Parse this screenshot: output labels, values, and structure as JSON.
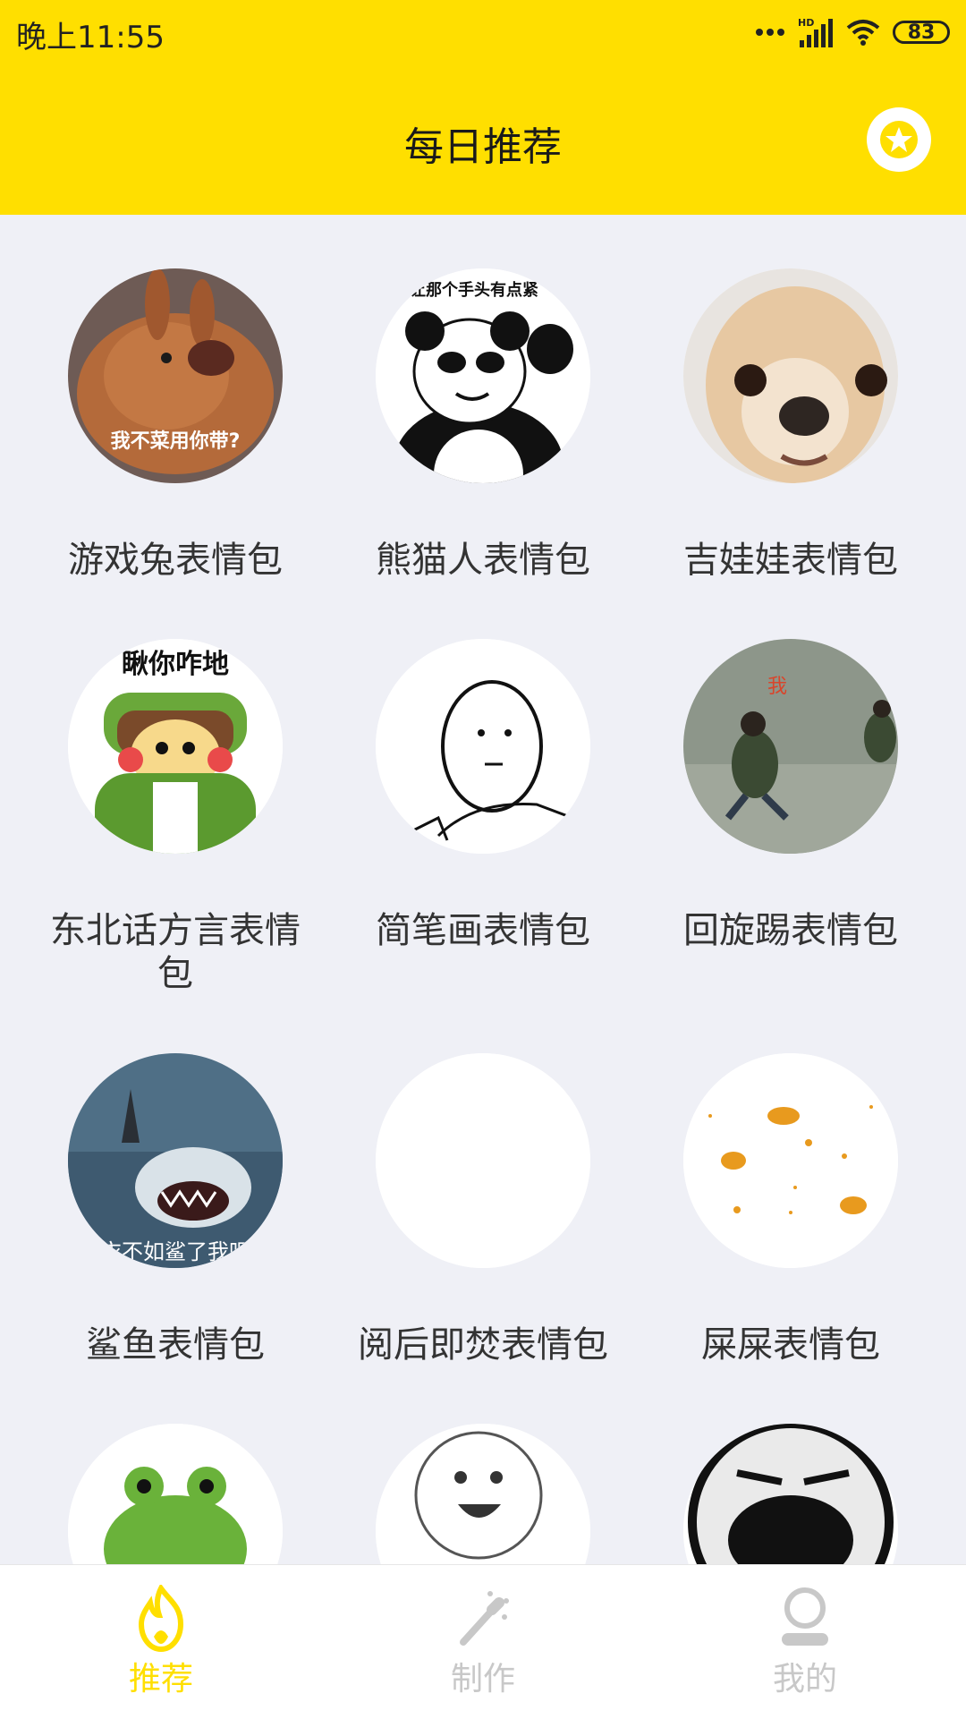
{
  "status_bar": {
    "time": "晚上11:55",
    "battery": "83",
    "network_label": "HD"
  },
  "header": {
    "title": "每日推荐",
    "favorite_icon": "star-icon"
  },
  "grid": {
    "items": [
      {
        "label": "游戏兔表情包",
        "image": "rabbit-meme-image",
        "caption": "我不菜用你带?"
      },
      {
        "label": "熊猫人表情包",
        "image": "panda-meme-image",
        "caption": "让那个手头有点紧"
      },
      {
        "label": "吉娃娃表情包",
        "image": "chihuahua-meme-image"
      },
      {
        "label": "东北话方言表情包",
        "image": "dongbei-meme-image",
        "caption": "瞅你咋地"
      },
      {
        "label": "简笔画表情包",
        "image": "stick-figure-meme-image"
      },
      {
        "label": "回旋踢表情包",
        "image": "spin-kick-meme-image",
        "caption": "我"
      },
      {
        "label": "鲨鱼表情包",
        "image": "shark-meme-image",
        "caption": "衣不如鲨了我吧"
      },
      {
        "label": "阅后即焚表情包",
        "image": "blank-meme-image"
      },
      {
        "label": "屎屎表情包",
        "image": "poop-meme-image"
      },
      {
        "label": "",
        "image": "frog-meme-image"
      },
      {
        "label": "",
        "image": "smiley-meme-image"
      },
      {
        "label": "",
        "image": "face-meme-image"
      }
    ]
  },
  "bottom_nav": {
    "items": [
      {
        "label": "推荐",
        "icon": "flame-icon",
        "active": true
      },
      {
        "label": "制作",
        "icon": "magic-wand-icon",
        "active": false
      },
      {
        "label": "我的",
        "icon": "user-icon",
        "active": false
      }
    ]
  },
  "colors": {
    "accent": "#ffdf00",
    "active_tab": "#ffdf00",
    "inactive_tab": "#c8c8c8",
    "background": "#eff0f6"
  }
}
